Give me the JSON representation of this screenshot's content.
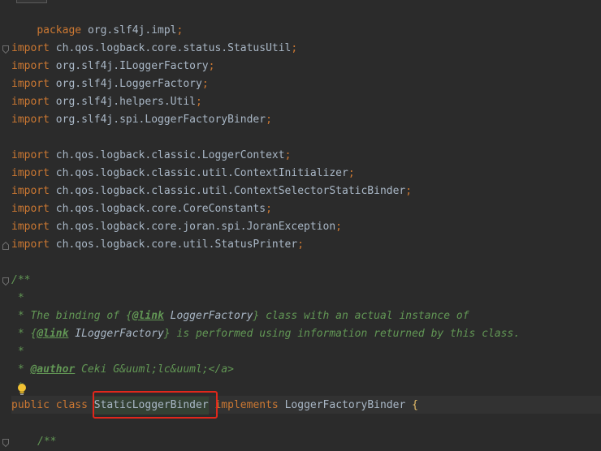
{
  "editor": {
    "package_kw": "package",
    "package_name": "org.slf4j.impl",
    "semicolon": ";",
    "import_kw": "import",
    "imports_group1": [
      "ch.qos.logback.core.status.StatusUtil",
      "org.slf4j.ILoggerFactory",
      "org.slf4j.LoggerFactory",
      "org.slf4j.helpers.Util",
      "org.slf4j.spi.LoggerFactoryBinder"
    ],
    "imports_group2": [
      "ch.qos.logback.classic.LoggerContext",
      "ch.qos.logback.classic.util.ContextInitializer",
      "ch.qos.logback.classic.util.ContextSelectorStaticBinder",
      "ch.qos.logback.core.CoreConstants",
      "ch.qos.logback.core.joran.spi.JoranException",
      "ch.qos.logback.core.util.StatusPrinter"
    ],
    "javadoc": {
      "open": "/**",
      "star": " *",
      "line1_pre": " * The binding of {",
      "line1_tag": "@link",
      "line1_ref": " LoggerFactory",
      "line1_post": "} class with an actual instance of",
      "line2_pre": " * {",
      "line2_tag": "@link",
      "line2_ref": " ILoggerFactory",
      "line2_post": "} is performed using information returned by this class.",
      "author_pre": " * ",
      "author_tag": "@author",
      "author_text": " Ceki G&uuml;lc&uuml;</a>",
      "close_star": " *"
    },
    "class_decl": {
      "public_kw": "public",
      "class_kw": "class",
      "class_name": "StaticLoggerBinder",
      "implements_kw": "implements",
      "interface_name": "LoggerFactoryBinder",
      "open_brace": "{"
    },
    "inner_javadoc_open": "/**"
  }
}
